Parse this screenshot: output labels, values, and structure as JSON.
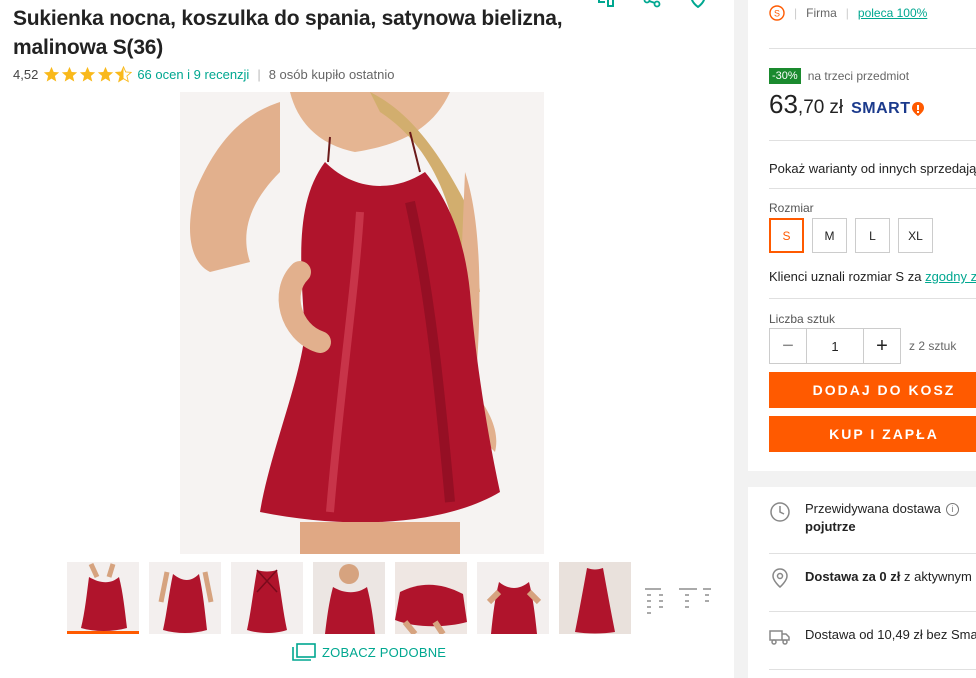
{
  "product": {
    "title": "Sukienka nocna, koszulka do spania, satynowa bielizna, malinowa S(36)",
    "rating_value": "4,52",
    "rating_stars": 4.5,
    "reviews_link": "66 ocen i 9 recenzji",
    "bought_recently": "8 osób kupiło ostatnio"
  },
  "top_icons": [
    "compare-icon",
    "share-icon",
    "heart-icon"
  ],
  "gallery": {
    "thumbnails_count": 8,
    "selected_index": 0,
    "similar_label": "ZOBACZ PODOBNE"
  },
  "seller": {
    "type": "Firma",
    "recommend": "poleca 100%"
  },
  "price": {
    "discount_badge": "-30%",
    "discount_text": "na trzeci przedmiot",
    "integer": "63",
    "decimal": ",70",
    "currency": "zł",
    "smart_label": "SMART"
  },
  "variants": {
    "other_sellers_text": "Pokaż warianty od innych sprzedają",
    "size_label": "Rozmiar",
    "sizes": [
      "S",
      "M",
      "L",
      "XL"
    ],
    "selected_size": "S",
    "fit_text": "Klienci uznali rozmiar S za ",
    "fit_link": "zgodny z"
  },
  "quantity": {
    "label": "Liczba sztuk",
    "value": "1",
    "of_text": "z 2 sztuk",
    "minus": "−",
    "plus": "+"
  },
  "buttons": {
    "add_to_cart": "DODAJ DO KOSZ",
    "buy_now": "KUP I ZAPŁA"
  },
  "delivery": {
    "expected_label": "Przewidywana dostawa",
    "expected_value": "pojutrze",
    "free_bold": "Dostawa za 0 zł",
    "free_rest": " z aktywnym",
    "paid_text": "Dostawa od 10,49 zł bez Smar"
  },
  "colors": {
    "accent_orange": "#ff5a00",
    "link_teal": "#00a790",
    "discount_green": "#1a8a2e",
    "smart_blue": "#1b3a8c",
    "dress_red": "#b0142c"
  }
}
